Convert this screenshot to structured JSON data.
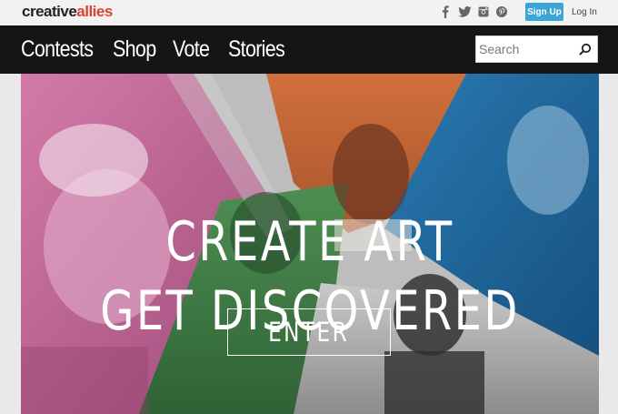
{
  "logo": {
    "part1": "creative",
    "part2": "allies"
  },
  "social": [
    {
      "icon": "facebook-icon",
      "glyph": "f"
    },
    {
      "icon": "twitter-icon"
    },
    {
      "icon": "instagram-icon"
    },
    {
      "icon": "pinterest-icon",
      "glyph": "P"
    }
  ],
  "auth": {
    "signup_label": "Sign Up",
    "login_label": "Log In"
  },
  "nav": {
    "items": [
      "Contests",
      "Shop",
      "Vote",
      "Stories"
    ]
  },
  "search": {
    "placeholder": "Search",
    "icon": "search-icon"
  },
  "hero": {
    "line1": "CREATE ART",
    "line2": "GET DISCOVERED",
    "cta_label": "ENTER"
  },
  "colors": {
    "brand_dark": "#222222",
    "brand_accent": "#d8442f",
    "signup_bg": "#3aa6d8",
    "nav_bg": "#151515",
    "panel_pink": "#c45a93",
    "panel_orange": "#c76a3a",
    "panel_blue": "#1e6aa0",
    "panel_green": "#3f7d45"
  }
}
